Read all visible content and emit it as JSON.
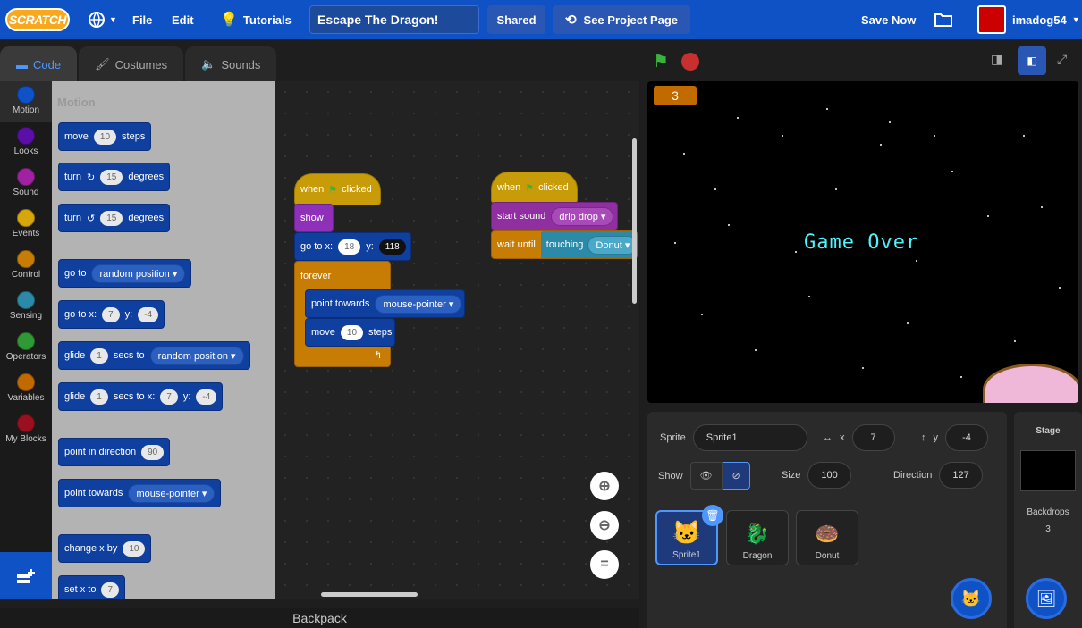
{
  "menu": {
    "logo": "SCRATCH",
    "file": "File",
    "edit": "Edit",
    "tutorials": "Tutorials",
    "project_title": "Escape The Dragon!",
    "shared": "Shared",
    "see_project": "See Project Page",
    "save_now": "Save Now",
    "username": "imadog54"
  },
  "tabs": {
    "code": "Code",
    "costumes": "Costumes",
    "sounds": "Sounds"
  },
  "categories": [
    {
      "label": "Motion",
      "color": "#0f52c6"
    },
    {
      "label": "Looks",
      "color": "#5b0fa6"
    },
    {
      "label": "Sound",
      "color": "#a022a0"
    },
    {
      "label": "Events",
      "color": "#d6a60c"
    },
    {
      "label": "Control",
      "color": "#c77d04"
    },
    {
      "label": "Sensing",
      "color": "#2a8aa8"
    },
    {
      "label": "Operators",
      "color": "#2f9a35"
    },
    {
      "label": "Variables",
      "color": "#c06a00"
    },
    {
      "label": "My Blocks",
      "color": "#9a1020"
    }
  ],
  "palette": {
    "heading": "Motion",
    "move": "move",
    "move_val": "10",
    "steps": "steps",
    "turn": "turn",
    "turn_cw_val": "15",
    "degrees": "degrees",
    "turn_ccw_val": "15",
    "goto": "go to",
    "goto_opt": "random position",
    "gotoxy": "go to x:",
    "gotoxy_x": "7",
    "y": "y:",
    "gotoxy_y": "-4",
    "glide": "glide",
    "glide_secs": "1",
    "secs_to": "secs to",
    "glide_opt": "random position",
    "glide2_secs": "1",
    "secs_to_x": "secs to x:",
    "glide_x": "7",
    "glide_y": "-4",
    "point_dir": "point in direction",
    "point_dir_val": "90",
    "point_towards": "point towards",
    "point_towards_opt": "mouse-pointer",
    "change_x": "change x by",
    "change_x_val": "10",
    "set_x": "set x to",
    "set_x_val": "7"
  },
  "script1": {
    "when": "when",
    "clicked": "clicked",
    "show": "show",
    "goto": "go to x:",
    "x": "18",
    "y_label": "y:",
    "y": "118",
    "forever": "forever",
    "point_towards": "point towards",
    "point_opt": "mouse-pointer",
    "move": "move",
    "move_val": "10",
    "steps": "steps"
  },
  "script2": {
    "when": "when",
    "clicked": "clicked",
    "start_sound": "start sound",
    "sound_opt": "drip drop",
    "wait_until": "wait until",
    "touching": "touching",
    "touch_opt": "Donut"
  },
  "backpack": "Backpack",
  "stage": {
    "variable_value": "3",
    "text": "Game Over"
  },
  "sprite_info": {
    "sprite_label": "Sprite",
    "sprite_name": "Sprite1",
    "x_label": "x",
    "x": "7",
    "y_label": "y",
    "y": "-4",
    "show_label": "Show",
    "size_label": "Size",
    "size": "100",
    "direction_label": "Direction",
    "direction": "127"
  },
  "sprites": [
    "Sprite1",
    "Dragon",
    "Donut"
  ],
  "stage_panel": {
    "title": "Stage",
    "backdrops_label": "Backdrops",
    "backdrops_count": "3"
  }
}
